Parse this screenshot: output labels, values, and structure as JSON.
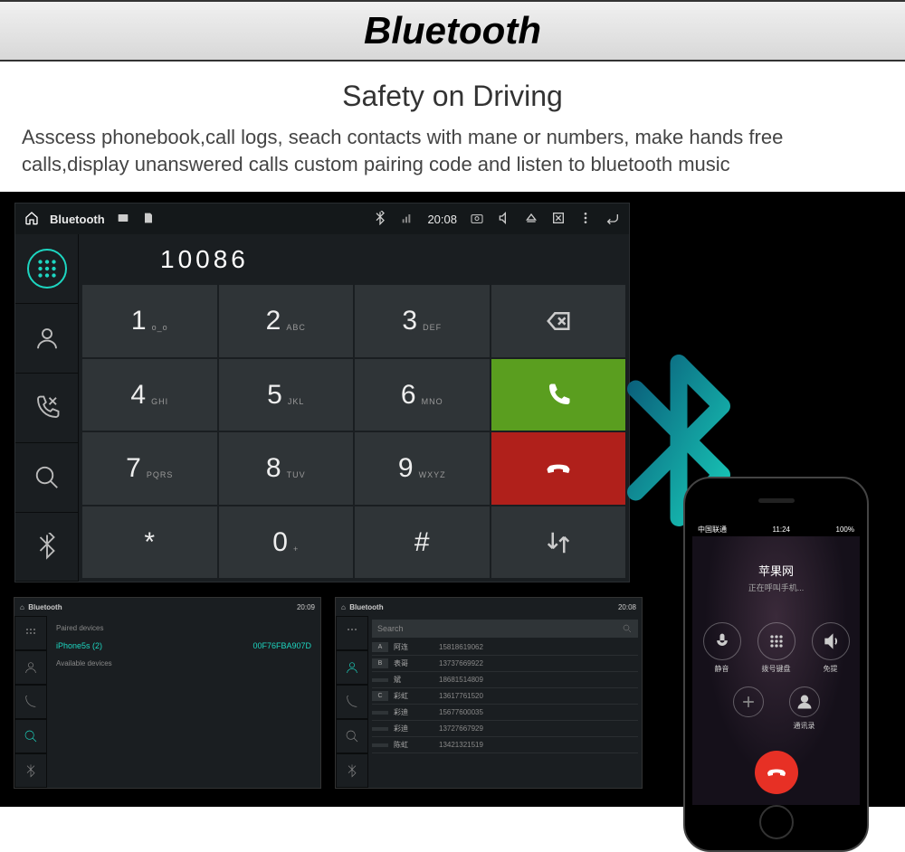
{
  "title": "Bluetooth",
  "subtitle": "Safety on Driving",
  "description": "Asscess phonebook,call logs, seach contacts with mane or numbers, make hands free calls,display unanswered calls custom pairing code and listen to bluetooth music",
  "statusbar": {
    "app": "Bluetooth",
    "time": "20:08"
  },
  "dialed": "10086",
  "keys": [
    {
      "d": "1",
      "l": "o_o"
    },
    {
      "d": "2",
      "l": "ABC"
    },
    {
      "d": "3",
      "l": "DEF"
    },
    {
      "d": "4",
      "l": "GHI"
    },
    {
      "d": "5",
      "l": "JKL"
    },
    {
      "d": "6",
      "l": "MNO"
    },
    {
      "d": "7",
      "l": "PQRS"
    },
    {
      "d": "8",
      "l": "TUV"
    },
    {
      "d": "9",
      "l": "WXYZ"
    },
    {
      "d": "*",
      "l": ""
    },
    {
      "d": "0",
      "l": "+"
    },
    {
      "d": "#",
      "l": ""
    }
  ],
  "phone": {
    "carrier": "中国联通",
    "time": "11:24",
    "battery": "100%",
    "title": "苹果网",
    "status": "正在呼叫手机...",
    "actions": [
      {
        "label": "静音"
      },
      {
        "label": "拨号键盘"
      },
      {
        "label": "免提"
      }
    ],
    "sec_right": "通讯录"
  },
  "thumb1": {
    "title": "Bluetooth",
    "time": "20:09",
    "paired_label": "Paired devices",
    "avail_label": "Available devices",
    "device_name": "iPhone5s (2)",
    "device_id": "00F76FBA907D"
  },
  "thumb2": {
    "title": "Bluetooth",
    "time": "20:08",
    "search": "Search",
    "contacts": [
      {
        "letter": "A",
        "name": "阿连",
        "num": "15818619062"
      },
      {
        "letter": "B",
        "name": "表哥",
        "num": "13737669922"
      },
      {
        "letter": "",
        "name": "斌",
        "num": "18681514809"
      },
      {
        "letter": "C",
        "name": "彩虹",
        "num": "13617761520"
      },
      {
        "letter": "",
        "name": "彩迪",
        "num": "15677600035"
      },
      {
        "letter": "",
        "name": "彩迪",
        "num": "13727667929"
      },
      {
        "letter": "",
        "name": "陈虹",
        "num": "13421321519"
      }
    ]
  }
}
